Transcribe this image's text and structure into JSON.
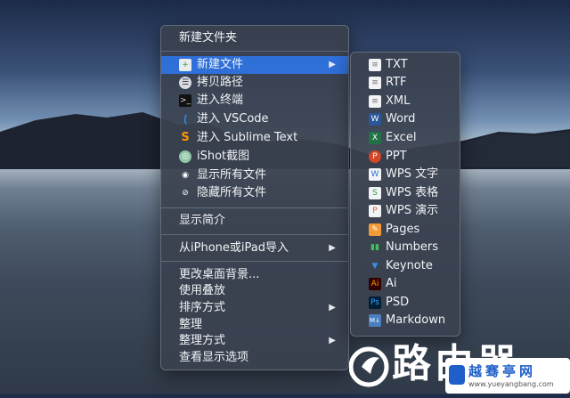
{
  "context_menu": {
    "new_folder": "新建文件夹",
    "new_file": "新建文件",
    "copy_path": "拷贝路径",
    "open_terminal": "进入终端",
    "open_vscode": "进入 VSCode",
    "open_sublime": "进入 Sublime Text",
    "ishot": "iShot截图",
    "show_hidden": "显示所有文件",
    "hide_hidden": "隐藏所有文件",
    "get_info": "显示简介",
    "import_device": "从iPhone或iPad导入",
    "change_background": "更改桌面背景...",
    "use_stacks": "使用叠放",
    "sort_by": "排序方式",
    "clean_up": "整理",
    "clean_up_by": "整理方式",
    "view_options": "查看显示选项"
  },
  "submenu": {
    "items": [
      "TXT",
      "RTF",
      "XML",
      "Word",
      "Excel",
      "PPT",
      "WPS 文字",
      "WPS 表格",
      "WPS 演示",
      "Pages",
      "Numbers",
      "Keynote",
      "Ai",
      "PSD",
      "Markdown"
    ],
    "icons": [
      "txt-file-icon",
      "rtf-file-icon",
      "xml-file-icon",
      "word-icon",
      "excel-icon",
      "ppt-icon",
      "wps-writer-icon",
      "wps-spreadsheet-icon",
      "wps-presentation-icon",
      "pages-icon",
      "numbers-icon",
      "keynote-icon",
      "illustrator-icon",
      "photoshop-icon",
      "markdown-icon"
    ]
  },
  "colors": {
    "menu_bg": "#3a4250",
    "highlight": "#2f6fd8",
    "text": "#f1f3f6"
  },
  "watermark": {
    "chinese_text": "路由器",
    "site_name": "越骞亭网",
    "url": "www.yueyangbang.com"
  }
}
